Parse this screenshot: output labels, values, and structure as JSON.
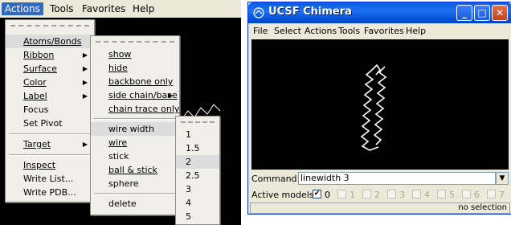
{
  "left_menubar": {
    "items": [
      "Actions",
      "Tools",
      "Favorites",
      "Help"
    ]
  },
  "actions_menu": {
    "atoms_bonds": "Atoms/Bonds",
    "ribbon": "Ribbon",
    "surface": "Surface",
    "color": "Color",
    "label": "Label",
    "focus": "Focus",
    "set_pivot": "Set Pivot",
    "target": "Target",
    "inspect": "Inspect",
    "write_list": "Write List...",
    "write_pdb": "Write PDB..."
  },
  "atoms_bonds_menu": {
    "show": "show",
    "hide": "hide",
    "backbone_only": "backbone only",
    "side_chain_base": "side chain/base",
    "chain_trace_only": "chain trace only",
    "wire_width": "wire width",
    "wire": "wire",
    "stick": "stick",
    "ball_stick": "ball & stick",
    "sphere": "sphere",
    "delete": "delete"
  },
  "wire_width_menu": {
    "options": [
      "1",
      "1.5",
      "2",
      "2.5",
      "3",
      "4",
      "5"
    ],
    "highlighted": "2"
  },
  "window": {
    "title": "UCSF Chimera",
    "menubar": [
      "File",
      "Select",
      "Actions",
      "Tools",
      "Favorites",
      "Help"
    ],
    "command_label": "Command:",
    "command_value": "linewidth 3",
    "active_models_label": "Active models:",
    "models": [
      {
        "num": "0",
        "checked": true,
        "enabled": true
      },
      {
        "num": "1",
        "checked": false,
        "enabled": false
      },
      {
        "num": "2",
        "checked": false,
        "enabled": false
      },
      {
        "num": "3",
        "checked": false,
        "enabled": false
      },
      {
        "num": "4",
        "checked": false,
        "enabled": false
      },
      {
        "num": "5",
        "checked": false,
        "enabled": false
      },
      {
        "num": "6",
        "checked": false,
        "enabled": false
      },
      {
        "num": "7",
        "checked": false,
        "enabled": false
      }
    ],
    "status": "no selection"
  },
  "colors": {
    "titlebar": "#0a5ee0",
    "menu_active": "#316ac5",
    "canvas": "#000000",
    "molecule": "#ffffff"
  }
}
